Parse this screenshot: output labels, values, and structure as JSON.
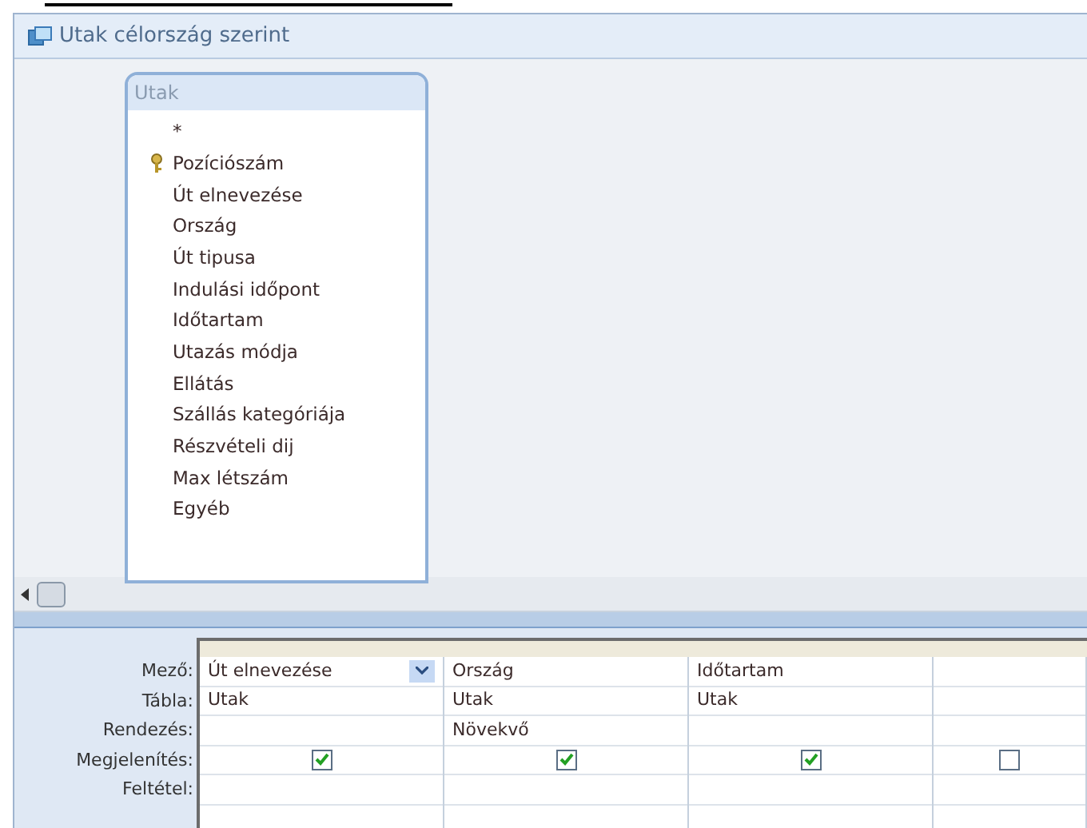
{
  "window": {
    "title": "Utak célország szerint"
  },
  "table": {
    "title": "Utak",
    "fields": [
      {
        "name": "*",
        "primary_key": false
      },
      {
        "name": "Pozíciószám",
        "primary_key": true
      },
      {
        "name": "Út elnevezése",
        "primary_key": false
      },
      {
        "name": "Ország",
        "primary_key": false
      },
      {
        "name": "Út tipusa",
        "primary_key": false
      },
      {
        "name": "Indulási időpont",
        "primary_key": false
      },
      {
        "name": "Időtartam",
        "primary_key": false
      },
      {
        "name": "Utazás módja",
        "primary_key": false
      },
      {
        "name": "Ellátás",
        "primary_key": false
      },
      {
        "name": "Szállás kategóriája",
        "primary_key": false
      },
      {
        "name": "Részvételi dij",
        "primary_key": false
      },
      {
        "name": "Max létszám",
        "primary_key": false
      },
      {
        "name": "Egyéb",
        "primary_key": false
      }
    ]
  },
  "grid": {
    "row_labels": [
      "Mező:",
      "Tábla:",
      "Rendezés:",
      "Megjelenítés:",
      "Feltétel:"
    ],
    "columns": [
      {
        "field": "Út elnevezése",
        "table": "Utak",
        "show": true,
        "selected": true
      },
      {
        "field": "Ország",
        "table": "Utak",
        "sort": "Növekvő",
        "show": true,
        "selected": false
      },
      {
        "field": "Időtartam",
        "table": "Utak",
        "show": true,
        "selected": false
      },
      {
        "show": false,
        "selected": false
      }
    ]
  }
}
